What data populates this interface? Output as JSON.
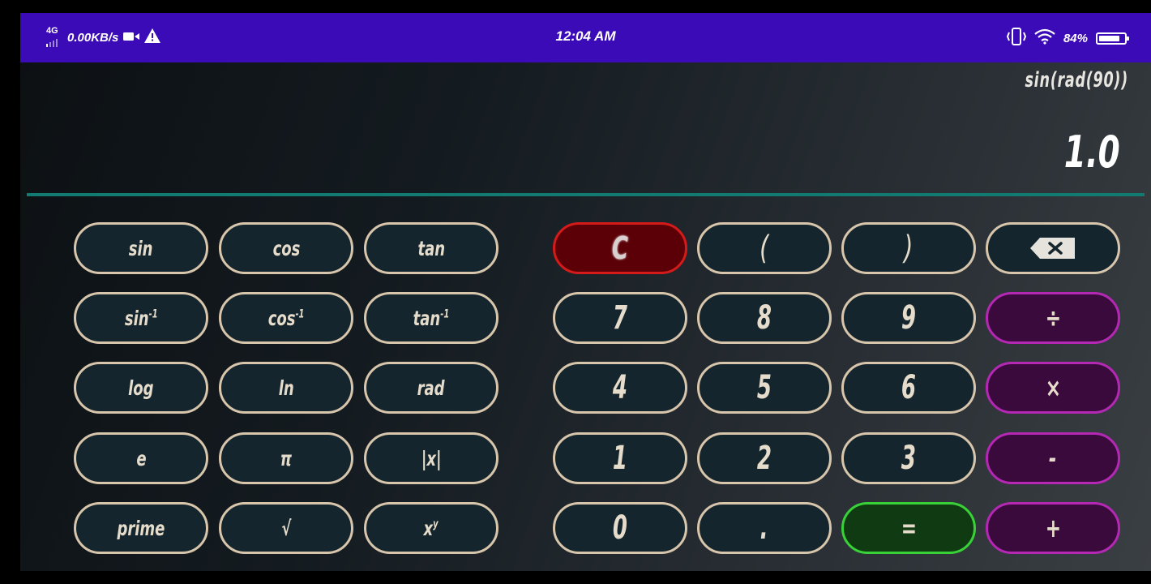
{
  "status_bar": {
    "network_type": "4G",
    "speed": "0.00KB/s",
    "time": "12:04 AM",
    "battery": "84%",
    "battery_fraction": 0.84,
    "background_color": "#3b0bb8",
    "icons": [
      "signal-icon",
      "video-icon",
      "warning-icon",
      "vibrate-icon",
      "wifi-icon",
      "battery-icon"
    ]
  },
  "display": {
    "expression": "sin(rad(90))",
    "result": "1.0",
    "divider_color": "#137a72"
  },
  "scientific_keys": {
    "sin": "sin",
    "cos": "cos",
    "tan": "tan",
    "asin_base": "sin",
    "acos_base": "cos",
    "atan_base": "tan",
    "inverse_exp": "-1",
    "log": "log",
    "ln": "ln",
    "rad": "rad",
    "e": "e",
    "pi": "π",
    "abs": "|x|",
    "prime": "prime",
    "sqrt": "√",
    "pow_base": "x",
    "pow_exp": "y"
  },
  "keypad": {
    "clear": "C",
    "open_paren": "(",
    "close_paren": ")",
    "backspace_icon": "backspace-icon",
    "seven": "7",
    "eight": "8",
    "nine": "9",
    "divide": "÷",
    "four": "4",
    "five": "5",
    "six": "6",
    "multiply": "×",
    "one": "1",
    "two": "2",
    "three": "3",
    "subtract": "-",
    "zero": "0",
    "decimal": ".",
    "equals": "=",
    "add": "+"
  },
  "colors": {
    "key_border": "#d8c6ac",
    "key_fill": "#14252d",
    "operator_border": "#b428b4",
    "operator_fill": "#3a0a3d",
    "clear_border": "#d51a1a",
    "clear_fill": "#5c0008",
    "equals_border": "#38d238",
    "equals_fill": "#0f3a12"
  }
}
